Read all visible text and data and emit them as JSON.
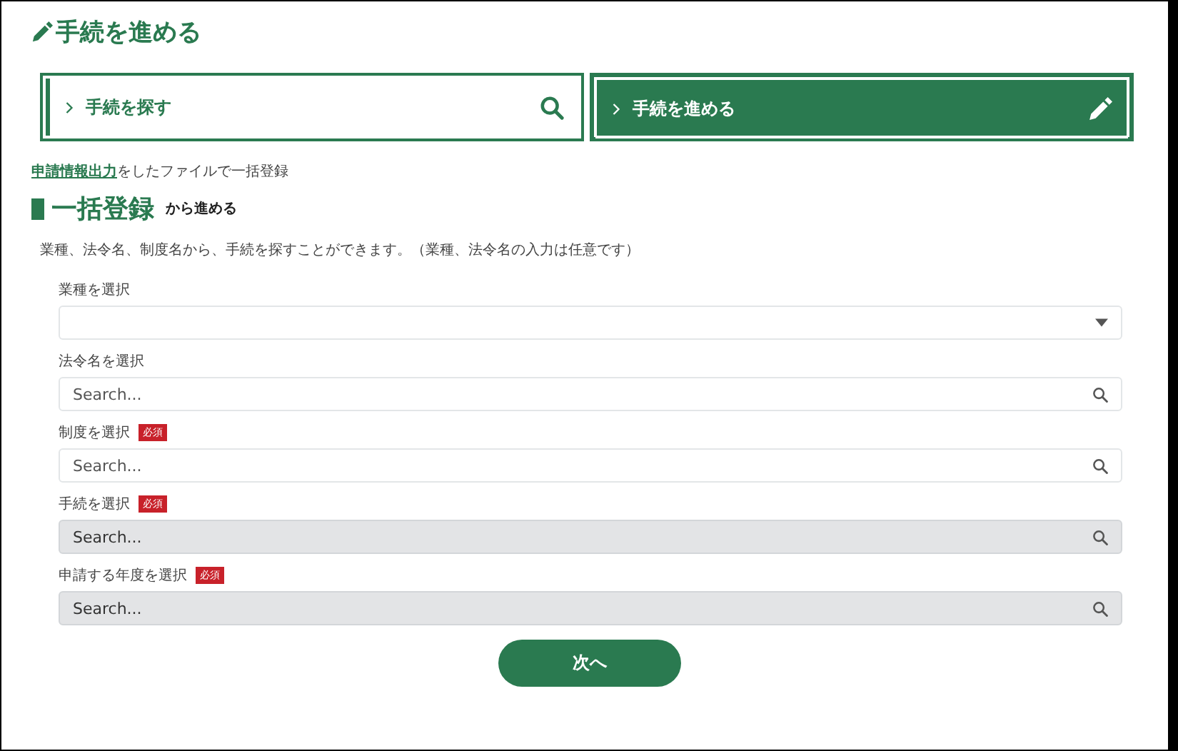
{
  "page_title": "手続を進める",
  "tabs": [
    {
      "label": "手続を探す",
      "selected": false,
      "kind": "search"
    },
    {
      "label": "手続を進める",
      "selected": true,
      "kind": "edit"
    }
  ],
  "bulk_note": {
    "link": "申請情報出力",
    "text": "をしたファイルで一括登録"
  },
  "section": {
    "title": "一括登録",
    "suffix": "から進める"
  },
  "description": "業種、法令名、制度名から、手続を探すことができます。（業種、法令名の入力は任意です）",
  "fields": [
    {
      "label": "業種を選択",
      "kind": "select",
      "disabled": false
    },
    {
      "label": "法令名を選択",
      "kind": "search",
      "placeholder": "Search...",
      "disabled": false
    },
    {
      "label": "制度を選択",
      "kind": "search",
      "placeholder": "Search...",
      "required": "必須",
      "disabled": false
    },
    {
      "label": "手続を選択",
      "kind": "search",
      "placeholder": "Search...",
      "required": "必須",
      "disabled": true
    },
    {
      "label": "申請する年度を選択",
      "kind": "search",
      "placeholder": "Search...",
      "required": "必須",
      "disabled": true
    }
  ],
  "next_button": "次へ"
}
